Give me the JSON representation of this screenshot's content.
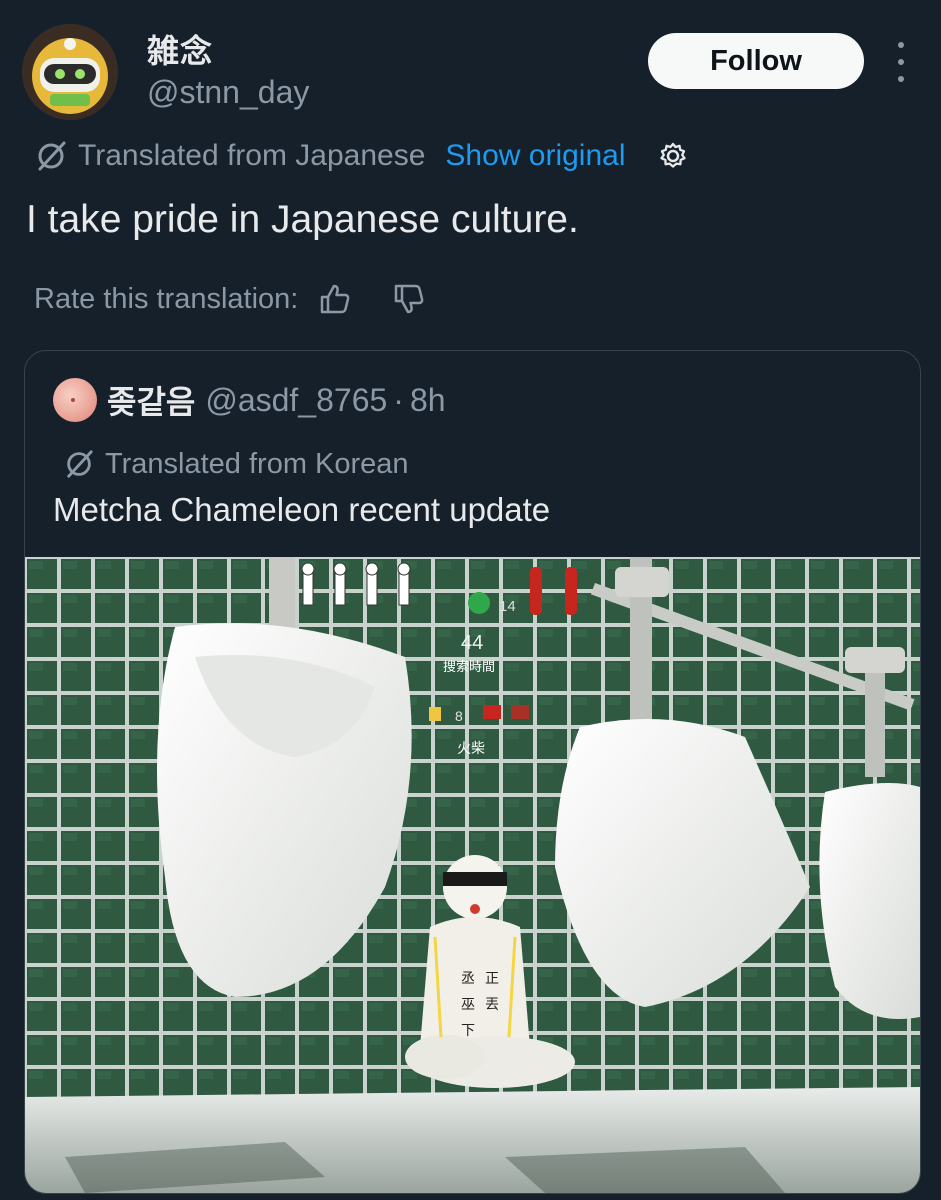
{
  "author": {
    "display_name": "雑念",
    "handle": "@stnn_day",
    "avatar_icon": "robot-avatar"
  },
  "follow_label": "Follow",
  "translation": {
    "label": "Translated from Japanese",
    "show_original": "Show original",
    "settings_icon": "gear-icon"
  },
  "tweet_text": "I take pride in Japanese culture.",
  "rate": {
    "label": "Rate this translation:",
    "up_icon": "thumbs-up-icon",
    "down_icon": "thumbs-down-icon"
  },
  "quote": {
    "display_name": "좆같음",
    "handle": "@asdf_8765",
    "separator": "·",
    "time": "8h",
    "translated_label": "Translated from Korean",
    "text": "Metcha Chameleon recent update",
    "media": {
      "hud": {
        "player_count": "14",
        "timer": "44",
        "timer_label": "搜索時間",
        "like_count": "8",
        "item_label": "火柴"
      },
      "figure_text": [
        "丞",
        "正",
        "巫",
        "丟",
        "下"
      ]
    }
  },
  "colors": {
    "background": "#16202b",
    "muted": "#8b98a5",
    "link": "#1d9bf0",
    "text": "#e7e9ea",
    "tile": "#2f5a41"
  }
}
